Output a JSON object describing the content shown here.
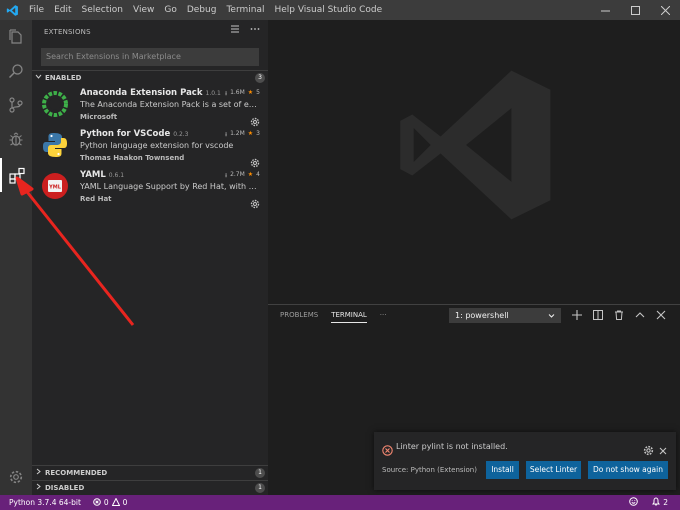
{
  "window": {
    "title": "Visual Studio Code",
    "menu": [
      "File",
      "Edit",
      "Selection",
      "View",
      "Go",
      "Debug",
      "Terminal",
      "Help"
    ]
  },
  "activity_bar": {
    "items": [
      "explorer-icon",
      "search-icon",
      "source-control-icon",
      "debug-icon",
      "extensions-icon"
    ],
    "active": "extensions-icon",
    "bottom": "gear-icon"
  },
  "sidebar": {
    "title": "EXTENSIONS",
    "search_placeholder": "Search Extensions in Marketplace",
    "enabled_label": "ENABLED",
    "enabled_count": "3",
    "extensions": [
      {
        "name": "Anaconda Extension Pack",
        "version": "1.0.1",
        "downloads": "1.6M",
        "rating": "5",
        "description": "The Anaconda Extension Pack is a set of exte...",
        "publisher": "Microsoft",
        "icon": "anaconda-icon"
      },
      {
        "name": "Python for VSCode",
        "version": "0.2.3",
        "downloads": "1.2M",
        "rating": "3",
        "description": "Python language extension for vscode",
        "publisher": "Thomas Haakon Townsend",
        "icon": "python-icon"
      },
      {
        "name": "YAML",
        "version": "0.6.1",
        "downloads": "2.7M",
        "rating": "4",
        "description": "YAML Language Support by Red Hat, with bui...",
        "publisher": "Red Hat",
        "icon": "yaml-icon"
      }
    ],
    "recommended_label": "RECOMMENDED",
    "recommended_count": "1",
    "disabled_label": "DISABLED",
    "disabled_count": "1"
  },
  "panel": {
    "tabs": [
      "PROBLEMS",
      "TERMINAL"
    ],
    "active_tab": "TERMINAL",
    "more": "···",
    "terminal_select": "1: powershell"
  },
  "notification": {
    "message": "Linter pylint is not installed.",
    "source": "Source: Python (Extension)",
    "buttons": [
      "Install",
      "Select Linter",
      "Do not show again"
    ]
  },
  "status_bar": {
    "python": "Python 3.7.4 64-bit",
    "errors": "0",
    "warnings": "0",
    "notifications": "2"
  },
  "colors": {
    "status_bar": "#68217a",
    "button": "#0e639c",
    "annotation_arrow": "#e8251f",
    "vscode_blue": "#007acc"
  }
}
